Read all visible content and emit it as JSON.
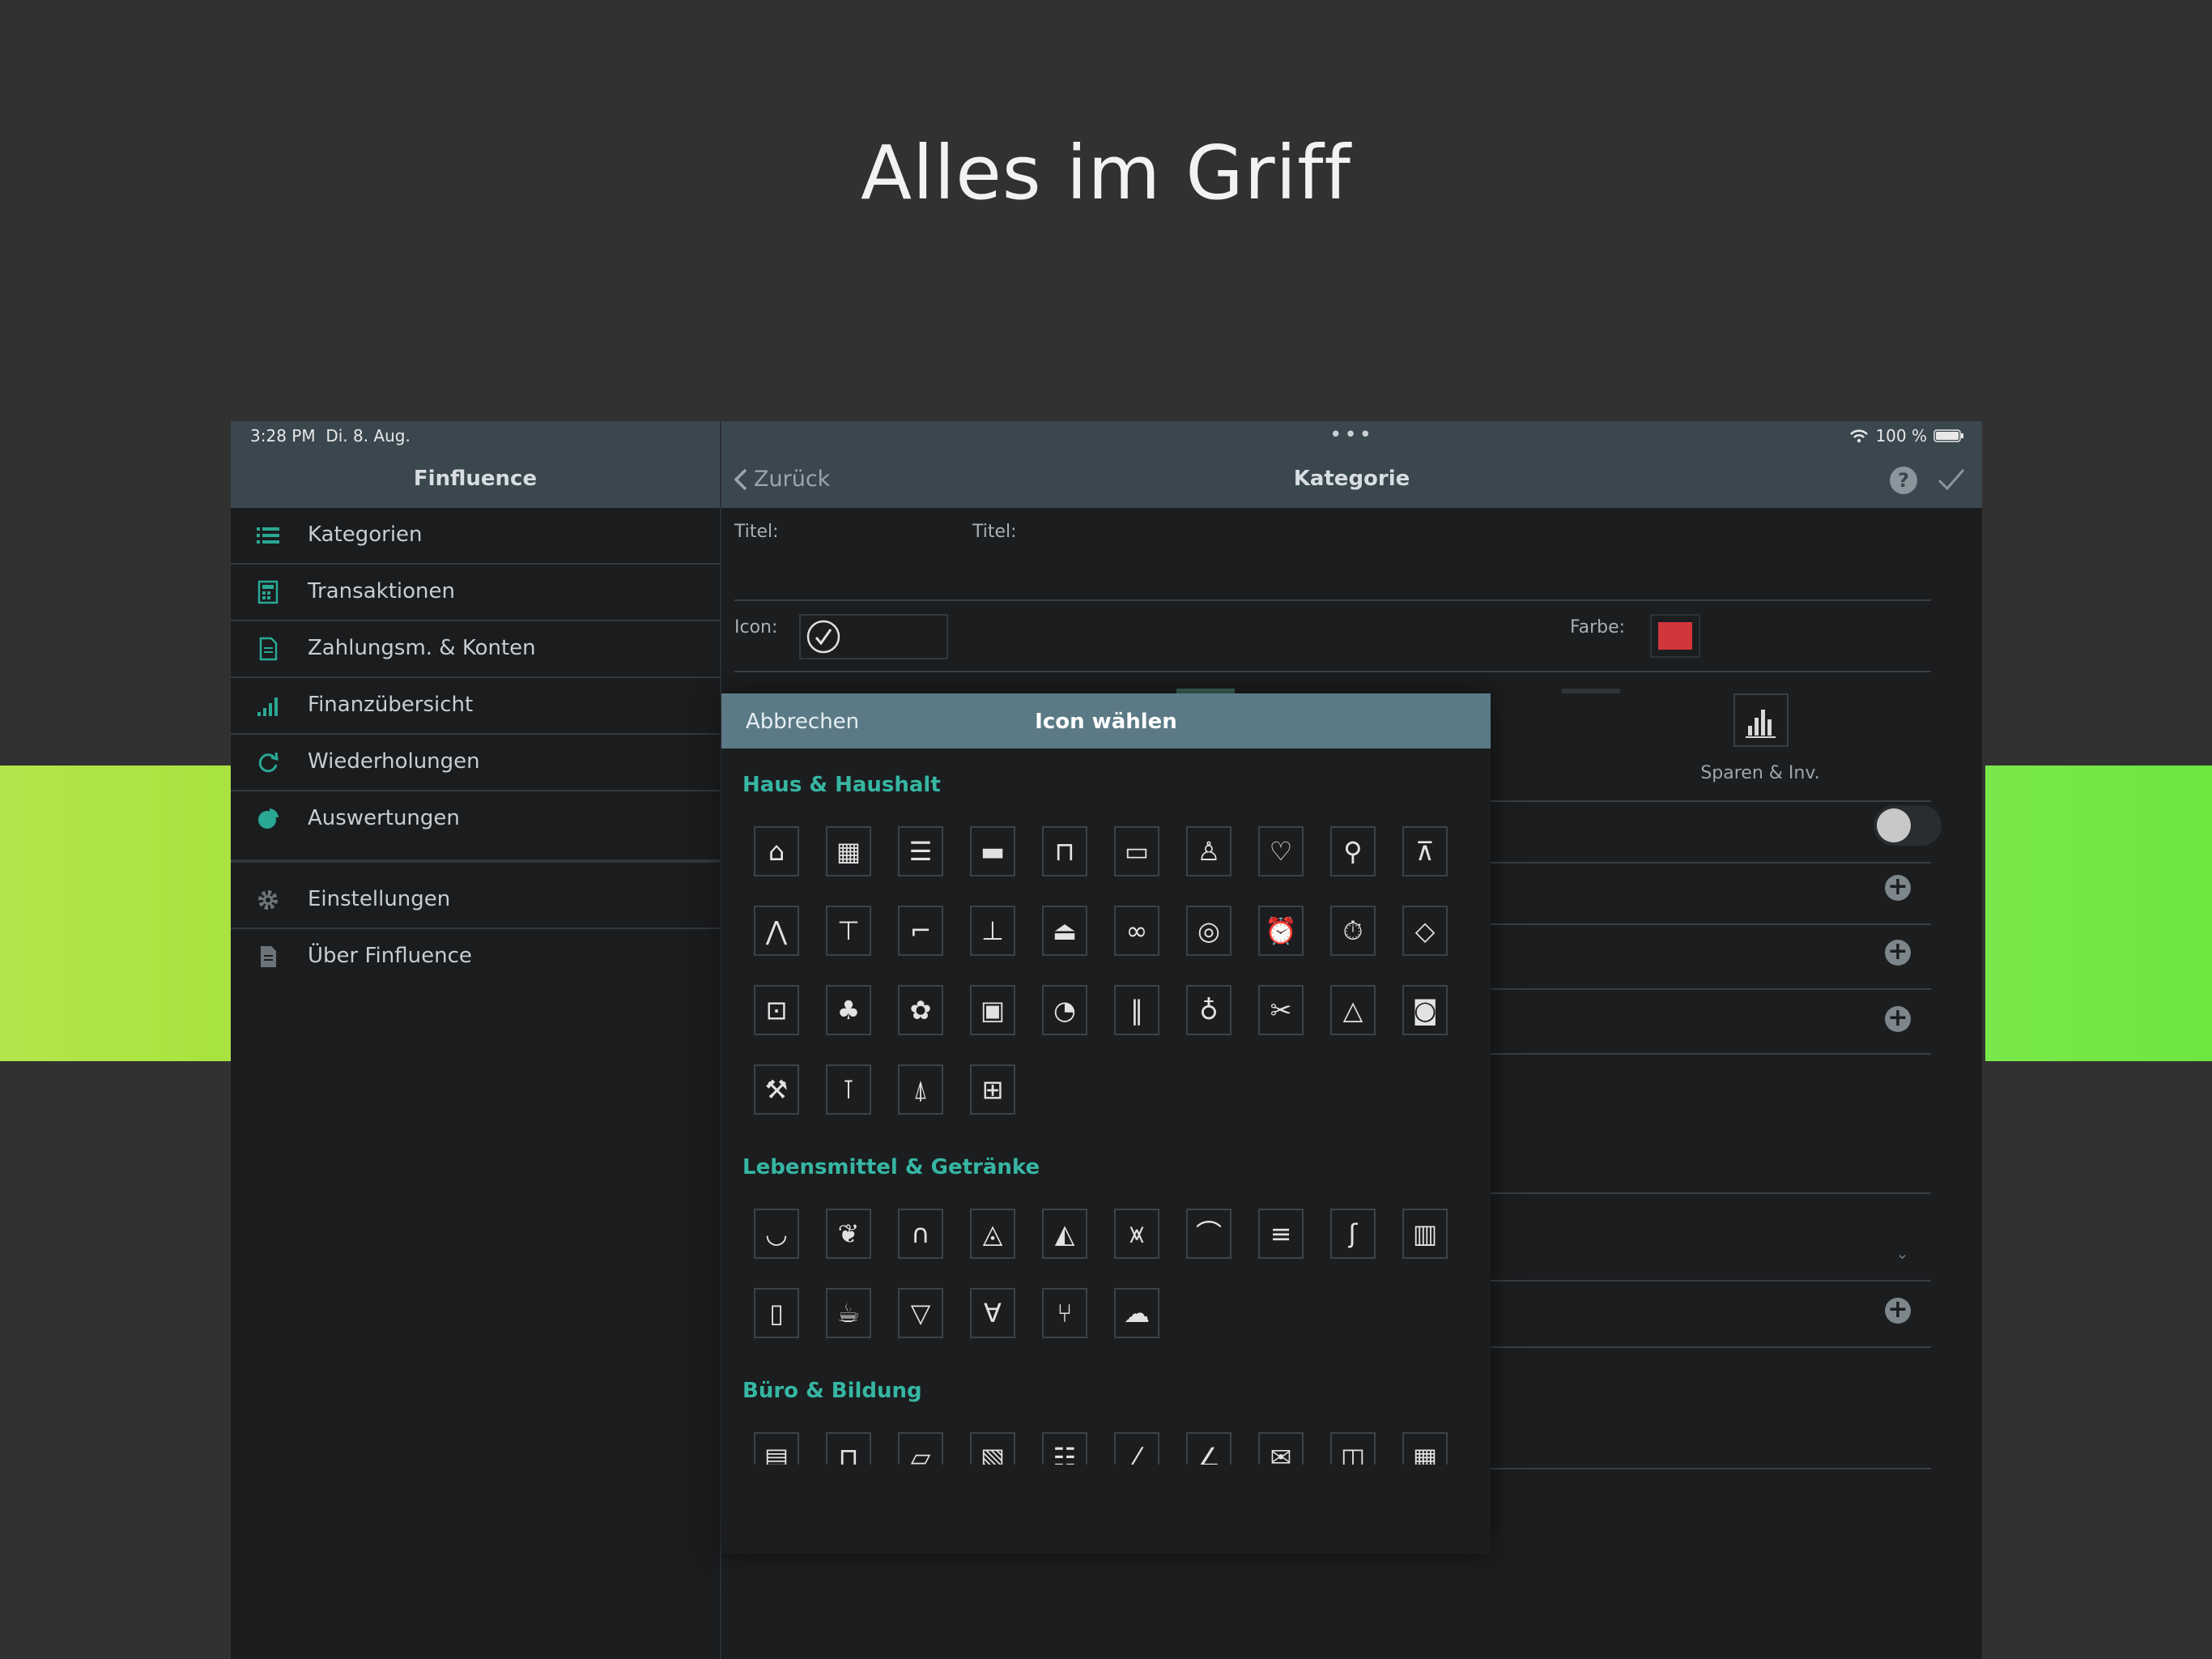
{
  "headline": "Alles im Griff",
  "status": {
    "time": "3:28 PM",
    "date": "Di. 8. Aug.",
    "battery": "100 %"
  },
  "sidebar": {
    "title": "Finfluence",
    "items": [
      {
        "label": "Kategorien",
        "icon": "list-icon"
      },
      {
        "label": "Transaktionen",
        "icon": "calculator-icon"
      },
      {
        "label": "Zahlungsm. & Konten",
        "icon": "document-icon"
      },
      {
        "label": "Finanzübersicht",
        "icon": "signal-bars-icon"
      },
      {
        "label": "Wiederholungen",
        "icon": "repeat-icon"
      },
      {
        "label": "Auswertungen",
        "icon": "pie-chart-icon"
      },
      {
        "label": "Einstellungen",
        "icon": "gear-icon"
      },
      {
        "label": "Über Finfluence",
        "icon": "info-document-icon"
      }
    ]
  },
  "detail": {
    "back_label": "Zurück",
    "title": "Kategorie",
    "help_label": "?",
    "form": {
      "title_label": "Titel:",
      "title_value": "",
      "icon_label": "Icon:",
      "color_label": "Farbe:",
      "color_value": "#d0363a"
    },
    "savings_label": "Sparen & Inv."
  },
  "popover": {
    "cancel_label": "Abbrechen",
    "title": "Icon wählen",
    "sections": [
      {
        "title": "Haus & Haushalt",
        "icons": [
          "house-icon",
          "building-icon",
          "cabinet-icon",
          "bed-icon",
          "armchair-icon",
          "tv-icon",
          "dress-icon",
          "onesie-icon",
          "stroller-icon",
          "sweater-icon",
          "jacket-icon",
          "tshirt-icon",
          "high-heel-icon",
          "shirt-icon",
          "iron-icon",
          "glasses-icon",
          "watch-icon",
          "alarm-clock-icon",
          "stopwatch-icon",
          "diamond-icon",
          "handbag-icon",
          "potted-plant-icon",
          "flower-icon",
          "picture-icon",
          "toilet-paper-icon",
          "cosmetics-icon",
          "perfume-icon",
          "scissors-comb-icon",
          "hanger-icon",
          "washing-machine-icon",
          "hammer-icon",
          "tool-icon",
          "brush-icon",
          "barrier-icon"
        ]
      },
      {
        "title": "Lebensmittel & Getränke",
        "icons": [
          "banana-icon",
          "fruit-icon",
          "bread-icon",
          "cheese-icon",
          "pizza-icon",
          "fries-icon",
          "croissant-icon",
          "cake-icon",
          "candy-cane-icon",
          "beer-icon",
          "bottle-icon",
          "coffee-cup-icon",
          "cocktail-icon",
          "wine-glass-icon",
          "cutlery-icon",
          "chef-hat-icon"
        ]
      },
      {
        "title": "Büro & Bildung",
        "icons": [
          "office-building-icon",
          "briefcase-icon",
          "folder-icon",
          "newspaper-icon",
          "notes-icon",
          "pen-icon",
          "compass-icon",
          "envelope-icon",
          "mailbox-icon",
          "calendar-icon"
        ]
      }
    ]
  }
}
